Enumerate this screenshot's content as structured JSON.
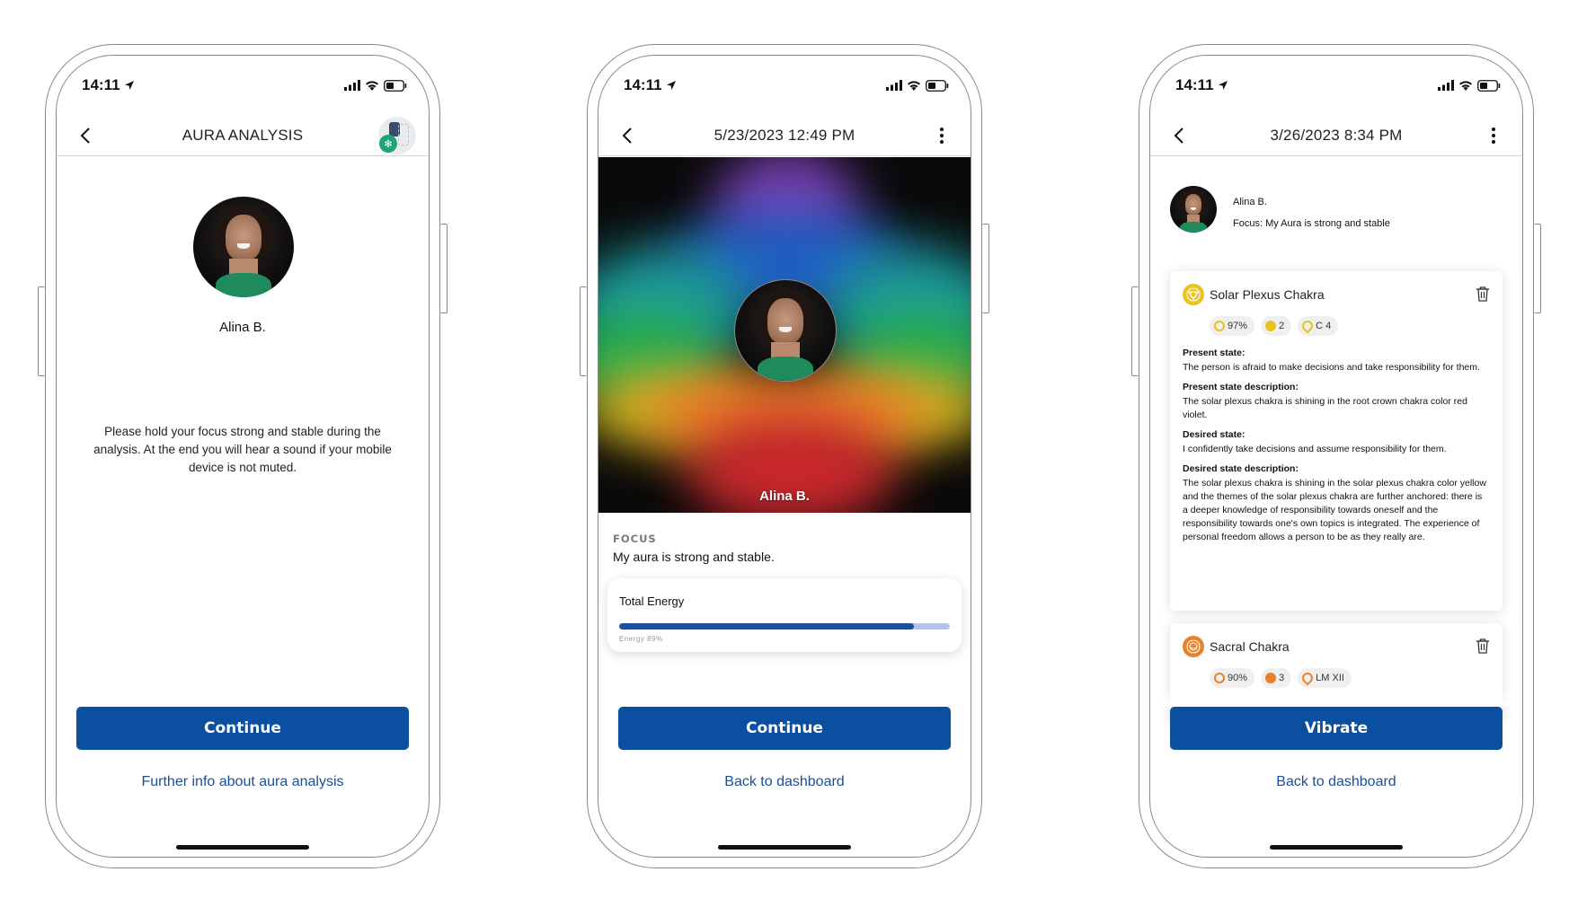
{
  "status_bar": {
    "time": "14:11"
  },
  "screens": [
    {
      "nav": {
        "title": "AURA ANALYSIS"
      },
      "user": {
        "name": "Alina B."
      },
      "instructions": "Please hold your focus strong and stable during the analysis. At the end you will hear a sound if your mobile device is not muted.",
      "primary_button": "Continue",
      "link": "Further info about aura analysis"
    },
    {
      "nav": {
        "title": "5/23/2023 12:49 PM"
      },
      "aura_image": {
        "name_overlay": "Alina B."
      },
      "focus": {
        "label": "FOCUS",
        "text": "My aura is strong and stable."
      },
      "energy": {
        "title": "Total Energy",
        "caption": "Energy 89%",
        "value_percent": 89
      },
      "primary_button": "Continue",
      "link": "Back to dashboard"
    },
    {
      "nav": {
        "title": "3/26/2023 8:34 PM"
      },
      "profile": {
        "name": "Alina B.",
        "focus_line": "Focus: My Aura is strong and stable"
      },
      "chakras": [
        {
          "name": "Solar Plexus Chakra",
          "color": "#e8c21f",
          "chips": [
            {
              "icon": "target-icon",
              "label": "97%"
            },
            {
              "icon": "gauge-icon",
              "label": "2"
            },
            {
              "icon": "drop-icon",
              "label": "C 4"
            }
          ],
          "present_state_label": "Present state:",
          "present_state": "The person is afraid to make decisions and take responsibility for them.",
          "present_desc_label": "Present state description:",
          "present_desc": "The solar plexus chakra is shining in the root crown chakra color red violet.",
          "desired_state_label": "Desired state:",
          "desired_state": "I confidently take decisions and assume responsibility for them.",
          "desired_desc_label": "Desired state description:",
          "desired_desc": "The solar plexus chakra is shining in the solar plexus chakra color yellow and the themes of the solar plexus chakra are further anchored: there is a deeper knowledge of responsibility towards oneself and the responsibility towards one's own topics is integrated. The experience of personal freedom allows a person to be as they really are."
        },
        {
          "name": "Sacral Chakra",
          "color": "#e8822a",
          "chips": [
            {
              "icon": "target-icon",
              "label": "90%"
            },
            {
              "icon": "gauge-icon",
              "label": "3"
            },
            {
              "icon": "drop-icon",
              "label": "LM XII"
            }
          ]
        }
      ],
      "primary_button": "Vibrate",
      "link": "Back to dashboard"
    }
  ],
  "colors": {
    "primary": "#0b4fa0",
    "link": "#1c4f93",
    "bluetooth": "#1fa472"
  }
}
